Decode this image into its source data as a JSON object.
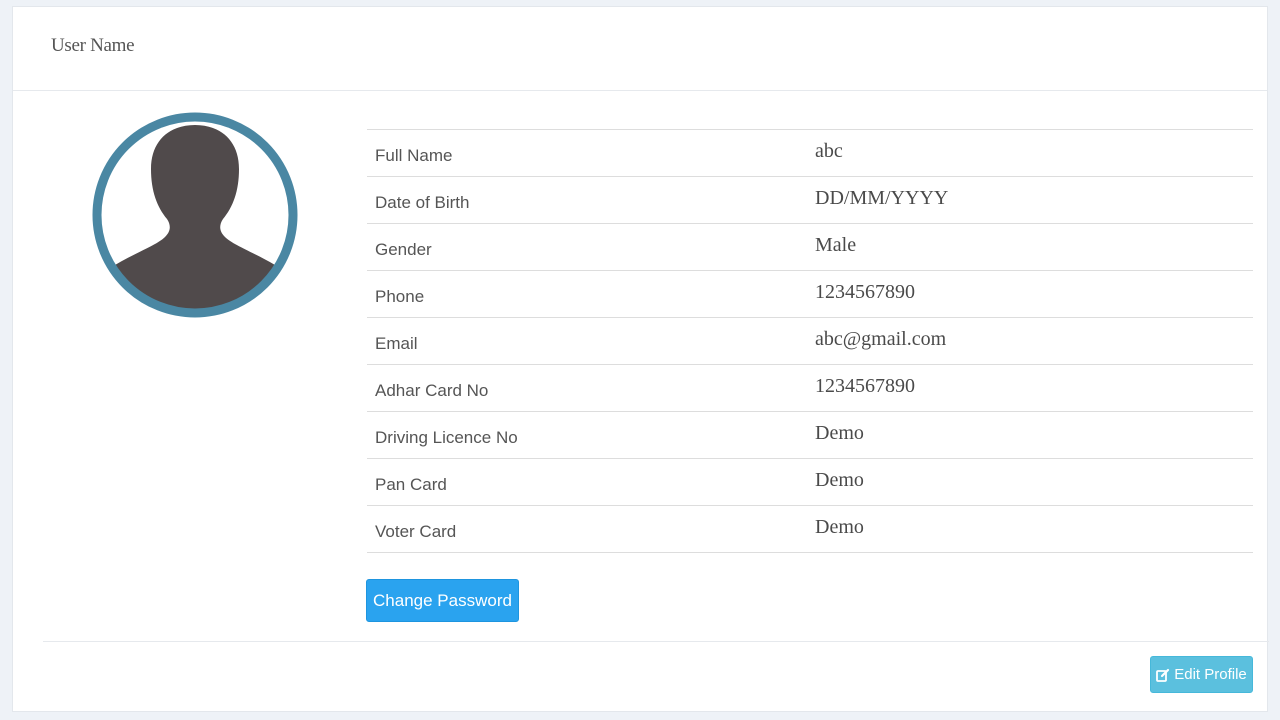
{
  "header": {
    "title": "User Name"
  },
  "profile": {
    "avatar_icon": "user-silhouette-icon",
    "rows": [
      {
        "label": "Full Name",
        "value": "abc"
      },
      {
        "label": "Date of Birth",
        "value": "DD/MM/YYYY"
      },
      {
        "label": "Gender",
        "value": "Male"
      },
      {
        "label": "Phone",
        "value": "1234567890"
      },
      {
        "label": "Email",
        "value": "abc@gmail.com"
      },
      {
        "label": "Adhar Card No",
        "value": "1234567890"
      },
      {
        "label": "Driving Licence No",
        "value": "Demo"
      },
      {
        "label": "Pan Card",
        "value": "Demo"
      },
      {
        "label": "Voter Card",
        "value": "Demo"
      }
    ]
  },
  "actions": {
    "change_password_label": "Change Password",
    "edit_profile_label": "Edit Profile",
    "edit_profile_icon": "edit-icon"
  },
  "colors": {
    "avatar_ring": "#4a87a3",
    "avatar_fill": "#504a4b",
    "primary_button": "#2aa3ef",
    "info_button": "#5bc0de"
  }
}
